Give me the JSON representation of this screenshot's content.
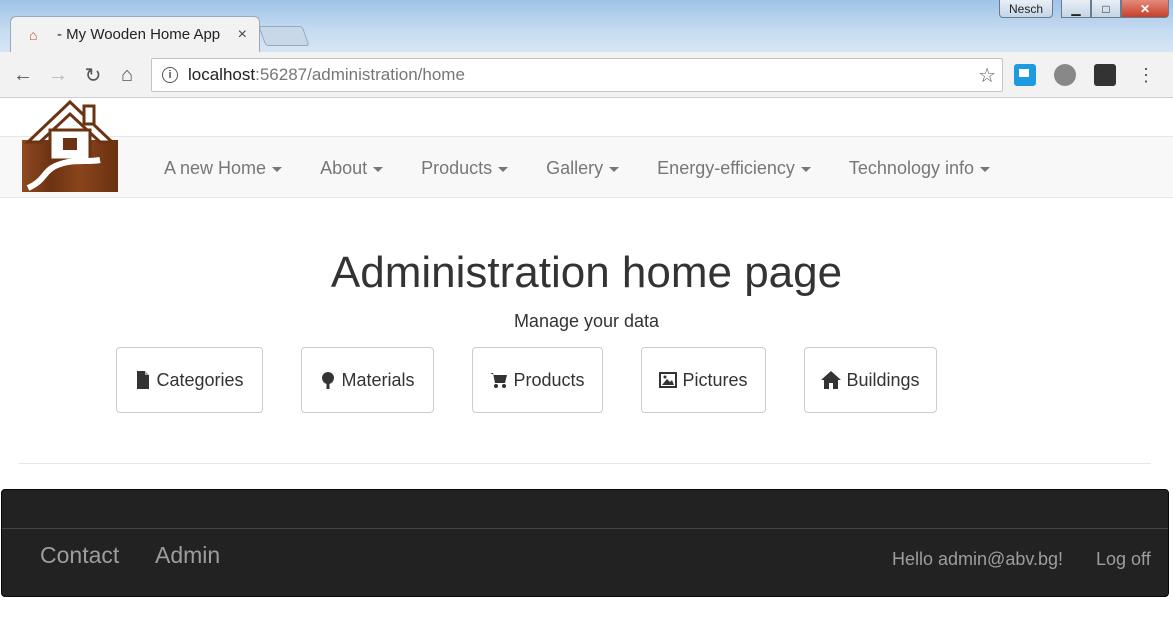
{
  "browser": {
    "tab_title": "- My Wooden Home App",
    "tab_close": "×",
    "user_badge": "Nesch",
    "url_host": "localhost",
    "url_rest": ":56287/administration/home"
  },
  "navbar": {
    "items": [
      {
        "label": "A new Home"
      },
      {
        "label": "About"
      },
      {
        "label": "Products"
      },
      {
        "label": "Gallery"
      },
      {
        "label": "Energy-efficiency"
      },
      {
        "label": "Technology info"
      }
    ]
  },
  "main": {
    "title": "Administration home page",
    "subtitle": "Manage your data",
    "buttons": [
      {
        "label": "Categories",
        "icon": "file-icon"
      },
      {
        "label": "Materials",
        "icon": "tree-icon"
      },
      {
        "label": "Products",
        "icon": "cart-icon"
      },
      {
        "label": "Pictures",
        "icon": "picture-icon"
      },
      {
        "label": "Buildings",
        "icon": "home-icon"
      }
    ]
  },
  "footer": {
    "contact": "Contact",
    "admin": "Admin",
    "greeting": "Hello admin@abv.bg!",
    "logoff": "Log off"
  },
  "colors": {
    "footer_bg": "#222222",
    "navbar_bg": "#f8f8f8",
    "nav_text": "#777777"
  }
}
